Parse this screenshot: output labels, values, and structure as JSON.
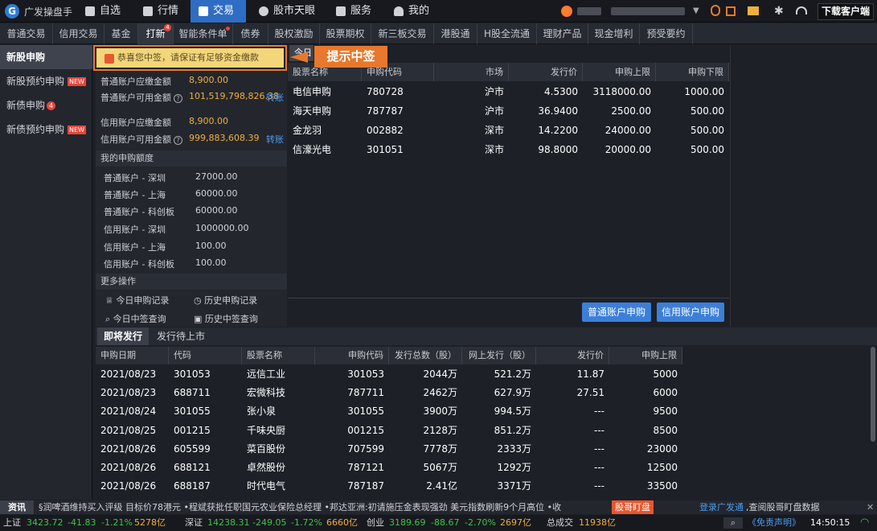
{
  "app": {
    "title": "广发操盘手",
    "logo": "G"
  },
  "nav": [
    {
      "label": "自选",
      "icon": "star-icon"
    },
    {
      "label": "行情",
      "icon": "chart-icon"
    },
    {
      "label": "交易",
      "icon": "trade-icon",
      "active": true
    },
    {
      "label": "股市天眼",
      "icon": "eye-icon"
    },
    {
      "label": "服务",
      "icon": "briefcase-icon"
    },
    {
      "label": "我的",
      "icon": "user-icon"
    }
  ],
  "download_label": "下载客户端",
  "tabs": [
    "普通交易",
    "信用交易",
    "基金",
    "打新",
    "智能条件单",
    "债券",
    "股权激励",
    "股票期权",
    "新三板交易",
    "港股通",
    "H股全流通",
    "理财产品",
    "现金增利",
    "预受要约"
  ],
  "tab_badge": "4",
  "sidebar": [
    {
      "label": "新股申购",
      "active": true
    },
    {
      "label": "新股预约申购",
      "tag": "NEW"
    },
    {
      "label": "新债申购",
      "badge": "4"
    },
    {
      "label": "新债预约申购",
      "tag": "NEW"
    }
  ],
  "toast": "恭喜您中签，请保证有足够资金缴款",
  "callout": "提示中签",
  "accounts": {
    "normal_due_label": "普通账户应缴金额",
    "normal_due": "8,900.00",
    "normal_avail_label": "普通账户可用金额",
    "normal_avail": "101,519,798,826.38",
    "credit_due_label": "信用账户应缴金额",
    "credit_due": "8,900.00",
    "credit_avail_label": "信用账户可用金额",
    "credit_avail": "999,883,608.39",
    "transfer": "转账"
  },
  "quota_header": "我的申购额度",
  "quota": [
    [
      "普通账户 - 深圳",
      "27000.00"
    ],
    [
      "普通账户 - 上海",
      "60000.00"
    ],
    [
      "普通账户 - 科创板",
      "60000.00"
    ],
    [
      "信用账户 - 深圳",
      "1000000.00"
    ],
    [
      "信用账户 - 上海",
      "100.00"
    ],
    [
      "信用账户 - 科创板",
      "100.00"
    ]
  ],
  "more_header": "更多操作",
  "more": [
    "今日申购记录",
    "历史申购记录",
    "今日中签查询",
    "历史中签查询"
  ],
  "today_tab": "今日",
  "today_cols": [
    "股票名称",
    "申购代码",
    "市场",
    "发行价",
    "申购上限",
    "申购下限"
  ],
  "today_rows": [
    [
      "电信申购",
      "780728",
      "沪市",
      "4.5300",
      "3118000.00",
      "1000.00"
    ],
    [
      "海天申购",
      "787787",
      "沪市",
      "36.9400",
      "2500.00",
      "500.00"
    ],
    [
      "金龙羽",
      "002882",
      "深市",
      "14.2200",
      "24000.00",
      "500.00"
    ],
    [
      "信濠光电",
      "301051",
      "深市",
      "98.8000",
      "20000.00",
      "500.00"
    ]
  ],
  "btn_normal": "普通账户申购",
  "btn_credit": "信用账户申购",
  "lower_tabs": [
    "即将发行",
    "发行待上市"
  ],
  "up_cols": [
    "申购日期",
    "代码",
    "股票名称",
    "申购代码",
    "发行总数（股）",
    "网上发行（股）",
    "发行价",
    "申购上限"
  ],
  "up_rows": [
    [
      "2021/08/23",
      "301053",
      "远信工业",
      "301053",
      "2044万",
      "521.2万",
      "11.87",
      "5000"
    ],
    [
      "2021/08/23",
      "688711",
      "宏微科技",
      "787711",
      "2462万",
      "627.9万",
      "27.51",
      "6000"
    ],
    [
      "2021/08/24",
      "301055",
      "张小泉",
      "301055",
      "3900万",
      "994.5万",
      "---",
      "9500"
    ],
    [
      "2021/08/25",
      "001215",
      "千味央厨",
      "001215",
      "2128万",
      "851.2万",
      "---",
      "8500"
    ],
    [
      "2021/08/26",
      "605599",
      "菜百股份",
      "707599",
      "7778万",
      "2333万",
      "---",
      "23000"
    ],
    [
      "2021/08/26",
      "688121",
      "卓然股份",
      "787121",
      "5067万",
      "1292万",
      "---",
      "12500"
    ],
    [
      "2021/08/26",
      "688187",
      "时代电气",
      "787187",
      "2.41亿",
      "3371万",
      "---",
      "33500"
    ]
  ],
  "news": {
    "label": "资讯",
    "text": "§润啤酒维持买入评级 目标价78港元   •程斌获批任职国元农业保险总经理   •邦达亚洲:初请施压金表现强劲 美元指数刷新9个月高位   •收",
    "tag": "股哥盯盘",
    "right_link": "登录广发通",
    "right_text": ",查阅股哥盯盘数据"
  },
  "status": {
    "sh_label": "上证",
    "sh": "3423.72",
    "sh_chg": "-41.83",
    "sh_pct": "-1.21%",
    "sh_amt": "5278亿",
    "sz_label": "深证",
    "sz": "14238.31",
    "sz_chg": "-249.05",
    "sz_pct": "-1.72%",
    "sz_amt": "6660亿",
    "cy_label": "创业",
    "cy": "3189.69",
    "cy_chg": "-88.67",
    "cy_pct": "-2.70%",
    "cy_amt": "2697亿",
    "total_label": "总成交",
    "total": "11938亿",
    "disclaimer": "《免责声明》",
    "time": "14:50:15"
  }
}
